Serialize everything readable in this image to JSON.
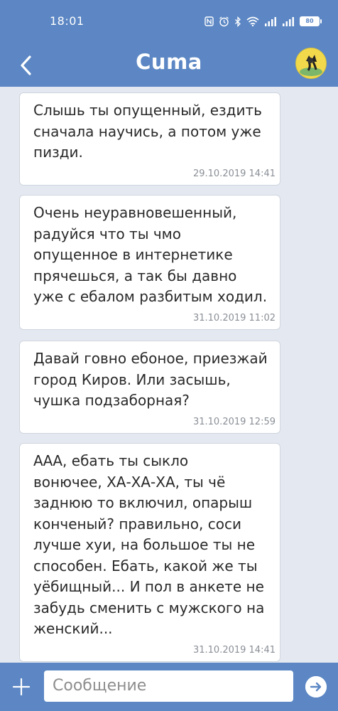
{
  "status_bar": {
    "time": "18:01",
    "battery_level": "80",
    "icons": [
      "nfc-icon",
      "alarm-icon",
      "bluetooth-icon",
      "wifi-icon",
      "signal-icon",
      "signal-icon",
      "battery-icon"
    ]
  },
  "header": {
    "title": "Сuma",
    "back_icon": "chevron-left-icon",
    "avatar": "contact-avatar"
  },
  "messages": [
    {
      "lines": [
        "Слышь ты опущенный, ездить",
        "сначала научись, а потом уже",
        "пизди."
      ],
      "timestamp": "29.10.2019 14:41"
    },
    {
      "lines": [
        "Очень неуравновешенный,",
        "радуйся что ты чмо",
        "опущенное в интернетике",
        "прячешься, а так бы давно",
        "уже с ебалом разбитым ходил."
      ],
      "timestamp": "31.10.2019 11:02"
    },
    {
      "lines": [
        "Давай говно ебоное, приезжай",
        "город Киров. Или засышь,",
        "чушка подзаборная?"
      ],
      "timestamp": "31.10.2019 12:59"
    },
    {
      "lines": [
        "ААА, ебать ты сыкло",
        "вонючее, ХА-ХА-ХА, ты чё",
        "заднюю то включил, опарыш",
        "конченый? правильно, соси",
        "лучше хуи, на большое ты не",
        "способен. Ебать, какой же ты",
        "уёбищный... И пол в анкете не",
        "забудь сменить с мужского на",
        "женский..."
      ],
      "timestamp": "31.10.2019 14:41"
    }
  ],
  "input_bar": {
    "placeholder": "Сообщение",
    "value": "",
    "attach_icon": "plus-icon",
    "send_icon": "send-arrow-icon"
  },
  "colors": {
    "primary": "#5c87c4",
    "background": "#e4e9f1",
    "bubble": "#ffffff",
    "timestamp": "#8a8f96"
  }
}
